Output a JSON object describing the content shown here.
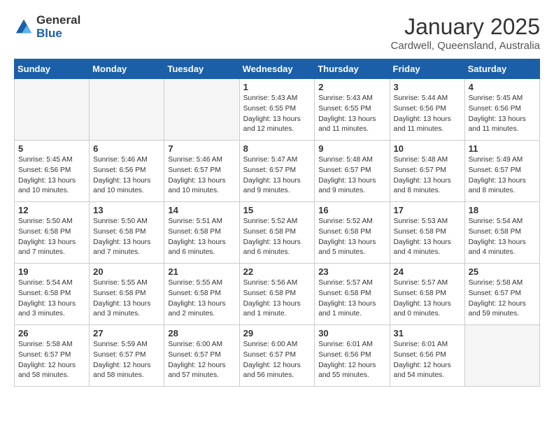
{
  "logo": {
    "general": "General",
    "blue": "Blue"
  },
  "title": "January 2025",
  "subtitle": "Cardwell, Queensland, Australia",
  "days_of_week": [
    "Sunday",
    "Monday",
    "Tuesday",
    "Wednesday",
    "Thursday",
    "Friday",
    "Saturday"
  ],
  "weeks": [
    [
      {
        "day": "",
        "info": ""
      },
      {
        "day": "",
        "info": ""
      },
      {
        "day": "",
        "info": ""
      },
      {
        "day": "1",
        "info": "Sunrise: 5:43 AM\nSunset: 6:55 PM\nDaylight: 13 hours\nand 12 minutes."
      },
      {
        "day": "2",
        "info": "Sunrise: 5:43 AM\nSunset: 6:55 PM\nDaylight: 13 hours\nand 11 minutes."
      },
      {
        "day": "3",
        "info": "Sunrise: 5:44 AM\nSunset: 6:56 PM\nDaylight: 13 hours\nand 11 minutes."
      },
      {
        "day": "4",
        "info": "Sunrise: 5:45 AM\nSunset: 6:56 PM\nDaylight: 13 hours\nand 11 minutes."
      }
    ],
    [
      {
        "day": "5",
        "info": "Sunrise: 5:45 AM\nSunset: 6:56 PM\nDaylight: 13 hours\nand 10 minutes."
      },
      {
        "day": "6",
        "info": "Sunrise: 5:46 AM\nSunset: 6:56 PM\nDaylight: 13 hours\nand 10 minutes."
      },
      {
        "day": "7",
        "info": "Sunrise: 5:46 AM\nSunset: 6:57 PM\nDaylight: 13 hours\nand 10 minutes."
      },
      {
        "day": "8",
        "info": "Sunrise: 5:47 AM\nSunset: 6:57 PM\nDaylight: 13 hours\nand 9 minutes."
      },
      {
        "day": "9",
        "info": "Sunrise: 5:48 AM\nSunset: 6:57 PM\nDaylight: 13 hours\nand 9 minutes."
      },
      {
        "day": "10",
        "info": "Sunrise: 5:48 AM\nSunset: 6:57 PM\nDaylight: 13 hours\nand 8 minutes."
      },
      {
        "day": "11",
        "info": "Sunrise: 5:49 AM\nSunset: 6:57 PM\nDaylight: 13 hours\nand 8 minutes."
      }
    ],
    [
      {
        "day": "12",
        "info": "Sunrise: 5:50 AM\nSunset: 6:58 PM\nDaylight: 13 hours\nand 7 minutes."
      },
      {
        "day": "13",
        "info": "Sunrise: 5:50 AM\nSunset: 6:58 PM\nDaylight: 13 hours\nand 7 minutes."
      },
      {
        "day": "14",
        "info": "Sunrise: 5:51 AM\nSunset: 6:58 PM\nDaylight: 13 hours\nand 6 minutes."
      },
      {
        "day": "15",
        "info": "Sunrise: 5:52 AM\nSunset: 6:58 PM\nDaylight: 13 hours\nand 6 minutes."
      },
      {
        "day": "16",
        "info": "Sunrise: 5:52 AM\nSunset: 6:58 PM\nDaylight: 13 hours\nand 5 minutes."
      },
      {
        "day": "17",
        "info": "Sunrise: 5:53 AM\nSunset: 6:58 PM\nDaylight: 13 hours\nand 4 minutes."
      },
      {
        "day": "18",
        "info": "Sunrise: 5:54 AM\nSunset: 6:58 PM\nDaylight: 13 hours\nand 4 minutes."
      }
    ],
    [
      {
        "day": "19",
        "info": "Sunrise: 5:54 AM\nSunset: 6:58 PM\nDaylight: 13 hours\nand 3 minutes."
      },
      {
        "day": "20",
        "info": "Sunrise: 5:55 AM\nSunset: 6:58 PM\nDaylight: 13 hours\nand 3 minutes."
      },
      {
        "day": "21",
        "info": "Sunrise: 5:55 AM\nSunset: 6:58 PM\nDaylight: 13 hours\nand 2 minutes."
      },
      {
        "day": "22",
        "info": "Sunrise: 5:56 AM\nSunset: 6:58 PM\nDaylight: 13 hours\nand 1 minute."
      },
      {
        "day": "23",
        "info": "Sunrise: 5:57 AM\nSunset: 6:58 PM\nDaylight: 13 hours\nand 1 minute."
      },
      {
        "day": "24",
        "info": "Sunrise: 5:57 AM\nSunset: 6:58 PM\nDaylight: 13 hours\nand 0 minutes."
      },
      {
        "day": "25",
        "info": "Sunrise: 5:58 AM\nSunset: 6:57 PM\nDaylight: 12 hours\nand 59 minutes."
      }
    ],
    [
      {
        "day": "26",
        "info": "Sunrise: 5:58 AM\nSunset: 6:57 PM\nDaylight: 12 hours\nand 58 minutes."
      },
      {
        "day": "27",
        "info": "Sunrise: 5:59 AM\nSunset: 6:57 PM\nDaylight: 12 hours\nand 58 minutes."
      },
      {
        "day": "28",
        "info": "Sunrise: 6:00 AM\nSunset: 6:57 PM\nDaylight: 12 hours\nand 57 minutes."
      },
      {
        "day": "29",
        "info": "Sunrise: 6:00 AM\nSunset: 6:57 PM\nDaylight: 12 hours\nand 56 minutes."
      },
      {
        "day": "30",
        "info": "Sunrise: 6:01 AM\nSunset: 6:56 PM\nDaylight: 12 hours\nand 55 minutes."
      },
      {
        "day": "31",
        "info": "Sunrise: 6:01 AM\nSunset: 6:56 PM\nDaylight: 12 hours\nand 54 minutes."
      },
      {
        "day": "",
        "info": ""
      }
    ]
  ]
}
